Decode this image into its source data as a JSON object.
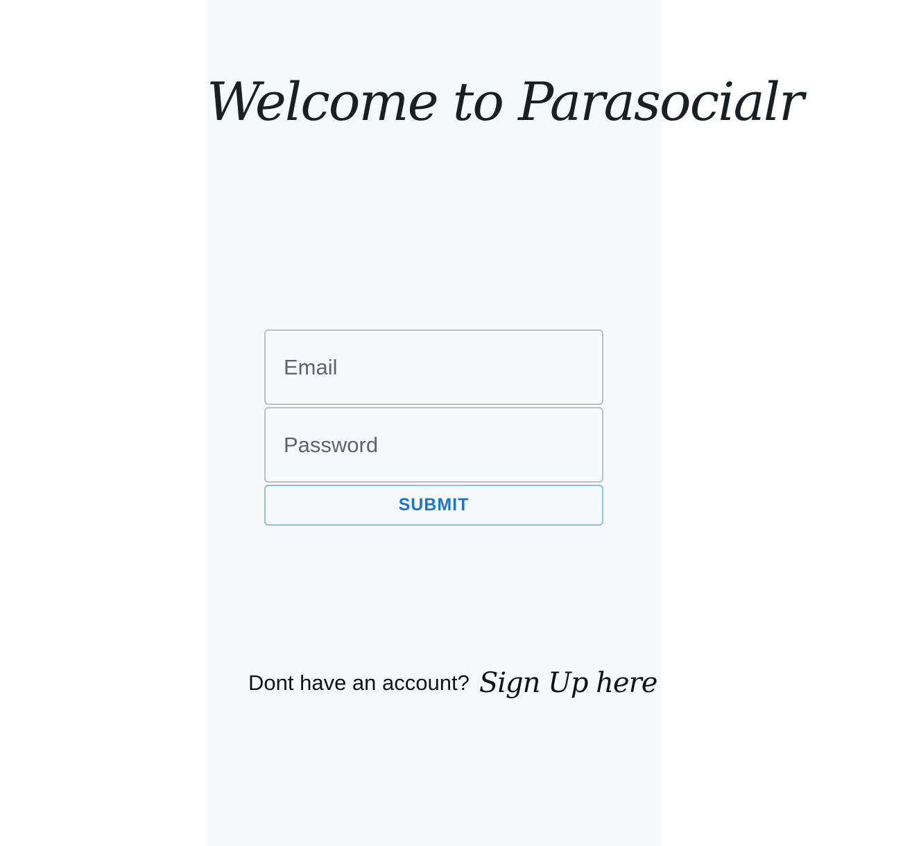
{
  "header": {
    "title": "Welcome to Parasocialr"
  },
  "login_form": {
    "email": {
      "value": "",
      "placeholder": "Email"
    },
    "password": {
      "value": "",
      "placeholder": "Password"
    },
    "submit_label": "SUBMIT"
  },
  "signup": {
    "prompt": "Dont have an account?",
    "link_label": "Sign Up here"
  },
  "colors": {
    "panel_background": "#f6fafd",
    "accent": "#1e74c8",
    "input_border": "#bfbfbf",
    "title_text": "#1a1f22"
  }
}
